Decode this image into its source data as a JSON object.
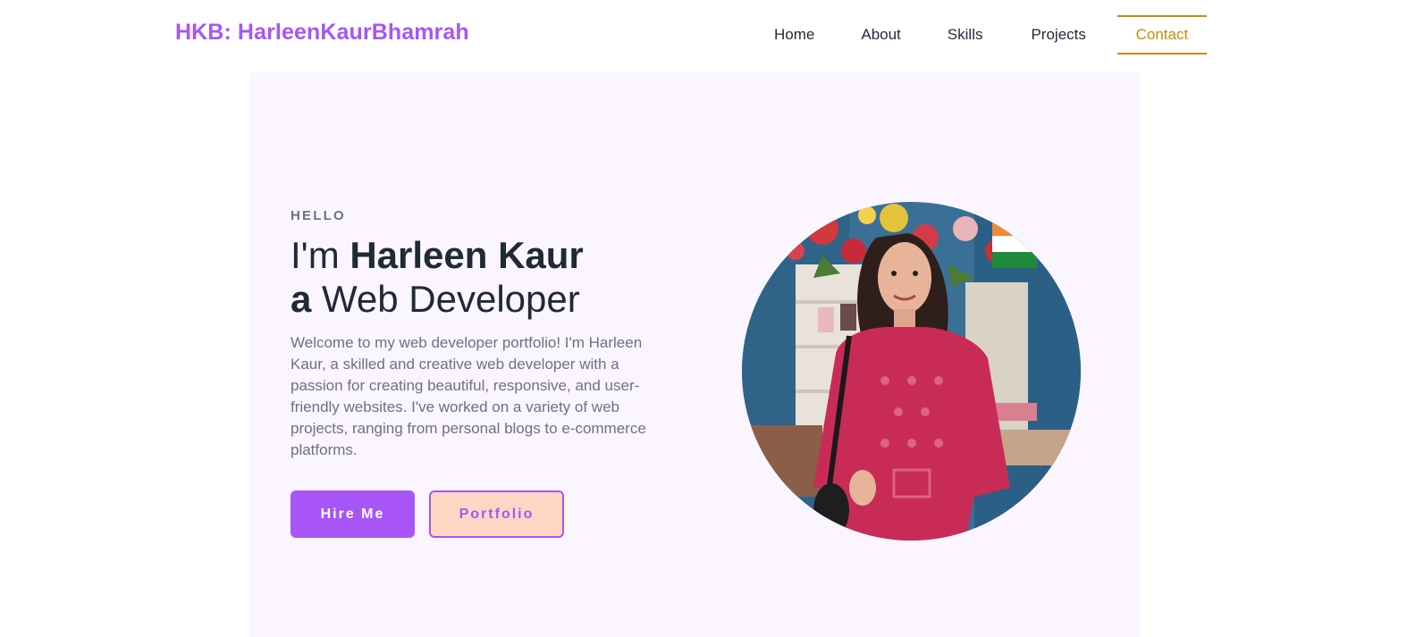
{
  "header": {
    "brand": "HKB: HarleenKaurBhamrah",
    "nav": [
      {
        "label": "Home"
      },
      {
        "label": "About"
      },
      {
        "label": "Skills"
      },
      {
        "label": "Projects"
      },
      {
        "label": "Contact",
        "active": true
      }
    ]
  },
  "hero": {
    "eyebrow": "HELLO",
    "headline": {
      "prefix": "I'm ",
      "name": "Harleen Kaur",
      "article": "a",
      "role": " Web Developer"
    },
    "intro": "Welcome to my web developer portfolio! I'm Harleen Kaur, a skilled and creative web developer with a passion for creating beautiful, responsive, and user-friendly websites. I've worked on a variety of web projects, ranging from personal blogs to e-commerce platforms.",
    "buttons": {
      "primary": "Hire Me",
      "secondary": "Portfolio"
    },
    "photo_icon": "profile-photo"
  },
  "colors": {
    "accent": "#a855f7",
    "active_nav": "#ca8a04",
    "hero_background": "#faf5ff",
    "secondary_button_bg": "#fed7c4"
  }
}
